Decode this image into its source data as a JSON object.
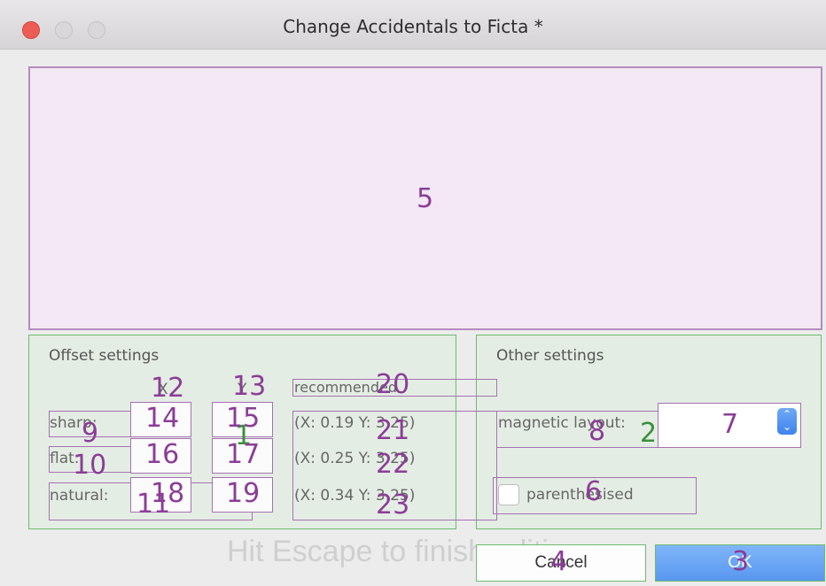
{
  "window": {
    "title": "Change Accidentals to Ficta *"
  },
  "offset_settings": {
    "title": "Offset settings",
    "col_x": "X",
    "col_y": "Y",
    "recommended_label": "recommended",
    "rows": [
      {
        "label": "sharp:",
        "recommended": "(X: 0.19 Y: 3.25)"
      },
      {
        "label": "flat:",
        "recommended": "(X: 0.25 Y: 3.25)"
      },
      {
        "label": "natural:",
        "recommended": "(X: 0.34 Y: 3.25)"
      }
    ]
  },
  "other_settings": {
    "title": "Other settings",
    "magnetic_layout_label": "magnetic layout:",
    "magnetic_layout_value": "7",
    "parenthesised_label": "parenthesised",
    "parenthesised_checked": false
  },
  "hint": "Hit Escape to finish editing",
  "buttons": {
    "cancel": "Cancel",
    "ok": "OK"
  },
  "overlay_labels": {
    "n1": "1",
    "n2": "2",
    "n3": "3",
    "n4": "4",
    "n5": "5",
    "n6": "6",
    "n7": "7",
    "n8": "8",
    "n9": "9",
    "n10": "10",
    "n11": "11",
    "n12": "12",
    "n13": "13",
    "n14": "14",
    "n15": "15",
    "n16": "16",
    "n17": "17",
    "n18": "18",
    "n19": "19",
    "n20": "20",
    "n21": "21",
    "n22": "22",
    "n23": "23"
  },
  "colors": {
    "overlay_purple": "#8b3d97",
    "overlay_green": "#3a8f3a",
    "close_red": "#ee5d55",
    "accent_blue": "#5897ef"
  }
}
